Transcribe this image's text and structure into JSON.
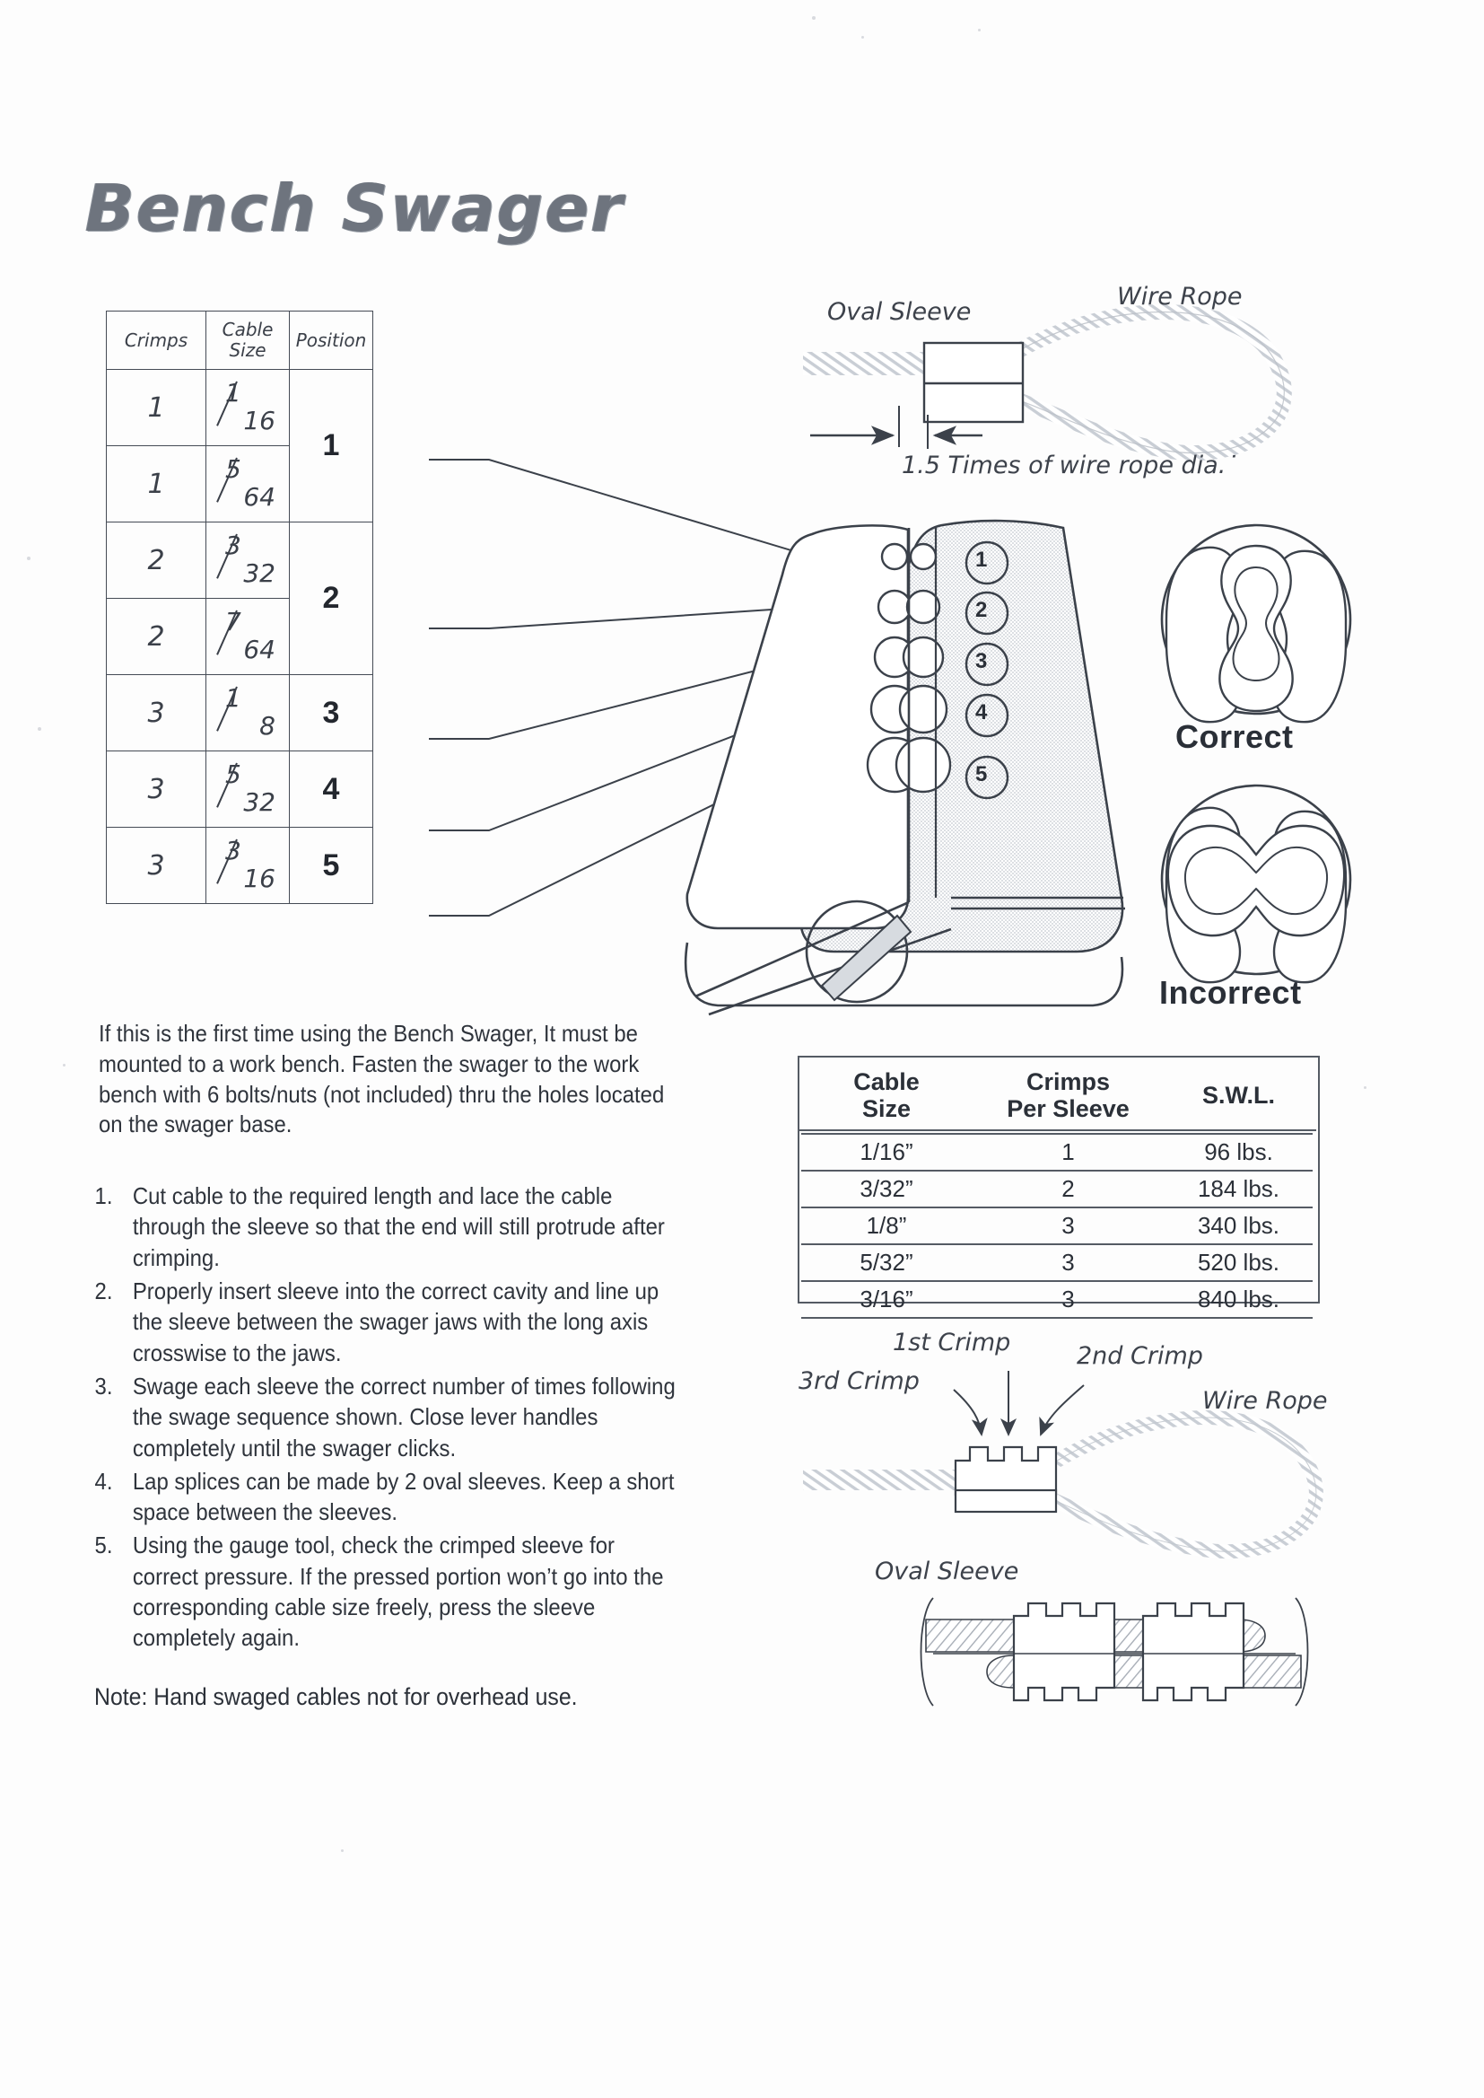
{
  "title": "Bench Swager",
  "crimp_table": {
    "headers": [
      "Crimps",
      "Cable Size",
      "Position"
    ],
    "header_cable": "Cable",
    "header_size": "Size",
    "rows": [
      {
        "crimps": "1",
        "num": "1",
        "den": "16",
        "position": "1",
        "rowspan": 2
      },
      {
        "crimps": "1",
        "num": "5",
        "den": "64"
      },
      {
        "crimps": "2",
        "num": "3",
        "den": "32",
        "position": "2",
        "rowspan": 2
      },
      {
        "crimps": "2",
        "num": "7",
        "den": "64"
      },
      {
        "crimps": "3",
        "num": "1",
        "den": "8",
        "position": "3",
        "rowspan": 1
      },
      {
        "crimps": "3",
        "num": "5",
        "den": "32",
        "position": "4",
        "rowspan": 1
      },
      {
        "crimps": "3",
        "num": "3",
        "den": "16",
        "position": "5",
        "rowspan": 1
      }
    ]
  },
  "diagram_top": {
    "oval_sleeve_label": "Oval Sleeve",
    "wire_rope_label": "Wire Rope",
    "dimension_label": "1.5 Times of wire rope dia.˙"
  },
  "swager": {
    "cavity_numbers": [
      "1",
      "2",
      "3",
      "4",
      "5"
    ]
  },
  "verdicts": {
    "correct": "Correct",
    "incorrect": "Incorrect"
  },
  "intro": "If this is the first time using the Bench Swager, It must be mounted to a work bench. Fasten the swager to the work bench with 6 bolts/nuts (not included) thru the holes located on the swager base.",
  "steps": [
    {
      "num": "1.",
      "text": "Cut cable to the required length and lace the cable through the sleeve so that the end will still protrude after crimping."
    },
    {
      "num": "2.",
      "text": "Properly insert sleeve into the correct cavity and line up the sleeve between the swager jaws with the long axis crosswise to the jaws."
    },
    {
      "num": "3.",
      "text": "Swage each sleeve the correct number of times following the swage sequence shown. Close lever handles completely until the swager clicks."
    },
    {
      "num": "4.",
      "text": "Lap splices can be made by 2 oval sleeves. Keep a short space between the sleeves."
    },
    {
      "num": "5.",
      "text": "Using the gauge tool, check the crimped sleeve for correct pressure.  If the pressed portion won’t go into the corresponding cable size freely, press the sleeve completely again."
    }
  ],
  "note": "Note: Hand swaged cables not for overhead use.",
  "swl_table": {
    "headers": [
      "Cable Size",
      "Crimps Per Sleeve",
      "S.W.L."
    ],
    "header_lines": {
      "c1_l1": "Cable",
      "c1_l2": "Size",
      "c2_l1": "Crimps",
      "c2_l2": "Per Sleeve",
      "c3_l1": "S.W.L.",
      "c3_l2": ""
    },
    "rows": [
      {
        "cable_size": "1/16”",
        "crimps": "1",
        "swl": "96 lbs."
      },
      {
        "cable_size": "3/32”",
        "crimps": "2",
        "swl": "184 lbs."
      },
      {
        "cable_size": "1/8”",
        "crimps": "3",
        "swl": "340 lbs."
      },
      {
        "cable_size": "5/32”",
        "crimps": "3",
        "swl": "520 lbs."
      },
      {
        "cable_size": "3/16”",
        "crimps": "3",
        "swl": "840 lbs."
      }
    ]
  },
  "diagram_bottom": {
    "first_crimp_label": "1st Crimp",
    "second_crimp_label": "2nd Crimp",
    "third_crimp_label": "3rd Crimp",
    "wire_rope_label": "Wire Rope",
    "oval_sleeve_label": "Oval Sleeve"
  },
  "colors": {
    "ink": "#2b3038",
    "line": "#454b55",
    "title": "#6e747e",
    "shade": "#dfe2e6"
  }
}
